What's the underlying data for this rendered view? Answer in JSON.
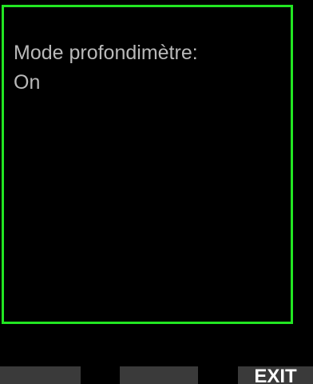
{
  "screen": {
    "setting_label": "Mode profondimètre:",
    "setting_value": "On"
  },
  "softkeys": {
    "left_label": "",
    "middle_label": "",
    "right_label": "EXIT"
  },
  "colors": {
    "frame": "#22e622",
    "text": "#b9b9b9",
    "background": "#000000",
    "softkey": "#3a3a3a"
  }
}
